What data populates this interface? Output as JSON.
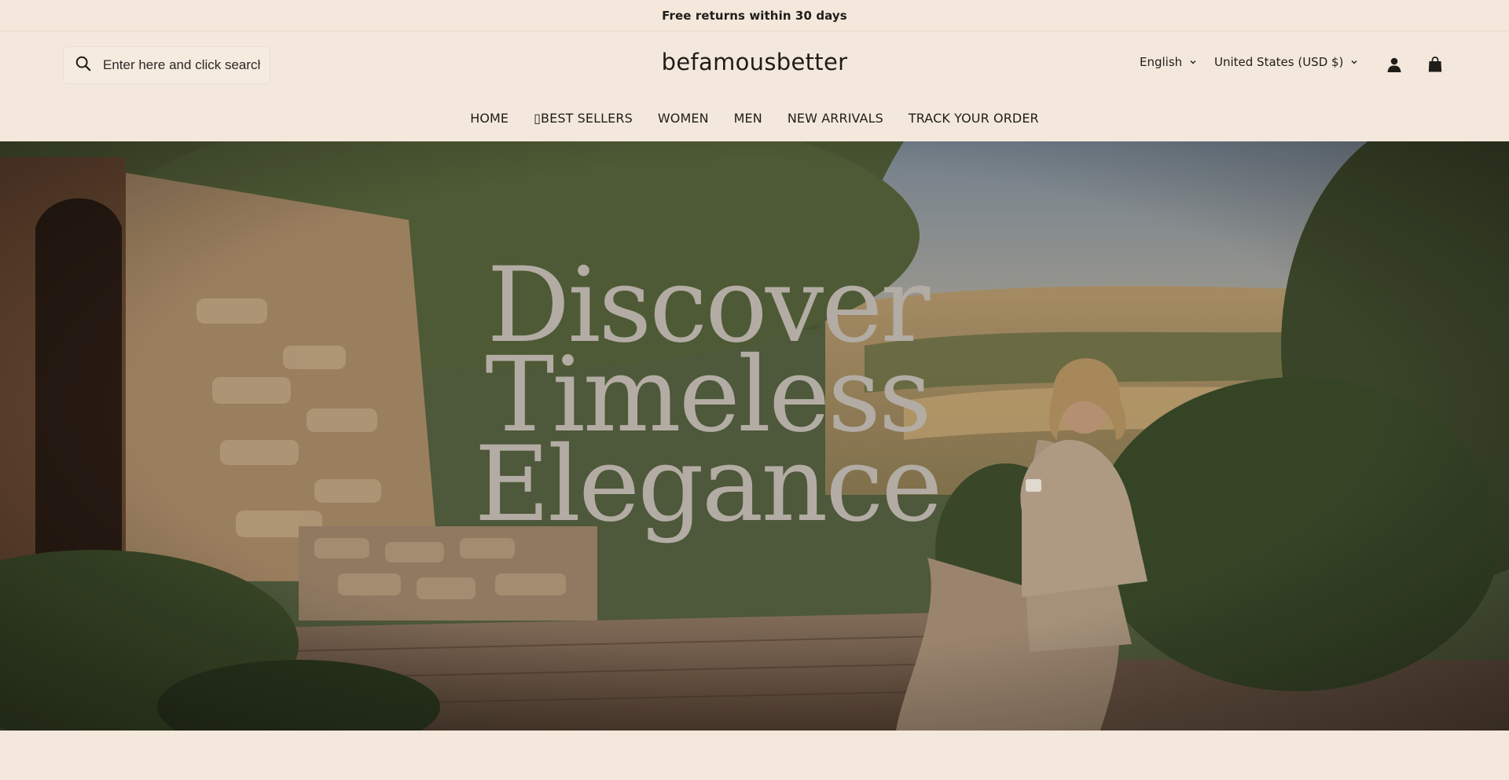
{
  "announcement": {
    "text": "Free returns within 30 days"
  },
  "header": {
    "search_placeholder": "Enter here and click search",
    "logo": "befamousbetter",
    "language": "English",
    "country": "United States (USD $)"
  },
  "nav": {
    "items": [
      {
        "label": "HOME"
      },
      {
        "label": "▯BEST SELLERS"
      },
      {
        "label": "WOMEN"
      },
      {
        "label": "MEN"
      },
      {
        "label": "NEW ARRIVALS"
      },
      {
        "label": "TRACK YOUR ORDER"
      }
    ]
  },
  "hero": {
    "lines": [
      "Discover",
      "Timeless",
      "Elegance"
    ]
  },
  "icons": {
    "search": "search-icon",
    "account": "account-icon",
    "cart": "shopping-bag-icon",
    "chevron": "chevron-down-icon"
  },
  "colors": {
    "background": "#f3e8db",
    "text": "#1f1d1a",
    "hero_text": "#b3aca4"
  }
}
